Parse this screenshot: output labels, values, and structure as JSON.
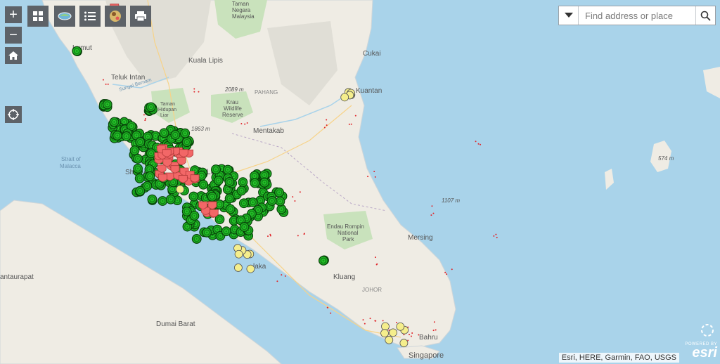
{
  "toolbar": {
    "zoom_in": "+",
    "zoom_out": "−",
    "tools": [
      {
        "name": "basemap-gallery-icon"
      },
      {
        "name": "layer-swap-icon"
      },
      {
        "name": "legend-list-icon"
      },
      {
        "name": "map-thumbnail-icon"
      },
      {
        "name": "print-icon"
      }
    ]
  },
  "search": {
    "placeholder": "Find address or place"
  },
  "attribution": "Esri, HERE, Garmin, FAO, USGS",
  "esri_logo": {
    "powered": "POWERED BY",
    "name": "esri"
  },
  "labels": {
    "taman_negara": "Taman\nNegara\nMalaysia",
    "lumut": "Lumut",
    "kuala_lipis": "Kuala Lipis",
    "teluk_intan": "Teluk Intan",
    "sungai_bernam": "Sungai Bernam",
    "pahang": "PAHANG",
    "elev_2089": "2089 m",
    "krau": "Krau\nWildlife\nReserve",
    "taman_genting": "Taman\nHidupan\nLiar",
    "elev_1863": "1863 m",
    "mentakab": "Mentakab",
    "kuantan": "Kuantan",
    "cukai": "Cukai",
    "strait": "Strait of\nMalacca",
    "shah_alam": "Shah A",
    "kuala_lumpur": "la Lu",
    "elev_574": "574 m",
    "elev_1107": "1107 m",
    "endau": "Endau Rompin\nNational\nPark",
    "mersing": "Mersing",
    "melaka": "laka",
    "kluang": "Kluang",
    "johor": "JOHOR",
    "tanjung": "antaurapat",
    "dumai": "Dumai Barat",
    "johor_bahru": "Bahru",
    "singapore": "Singapore"
  },
  "colors": {
    "water": "#a9d3ea",
    "land": "#efece4",
    "green_marker": "#19b11d",
    "red_marker": "#f26767",
    "yellow_marker": "#f5ee8c"
  }
}
